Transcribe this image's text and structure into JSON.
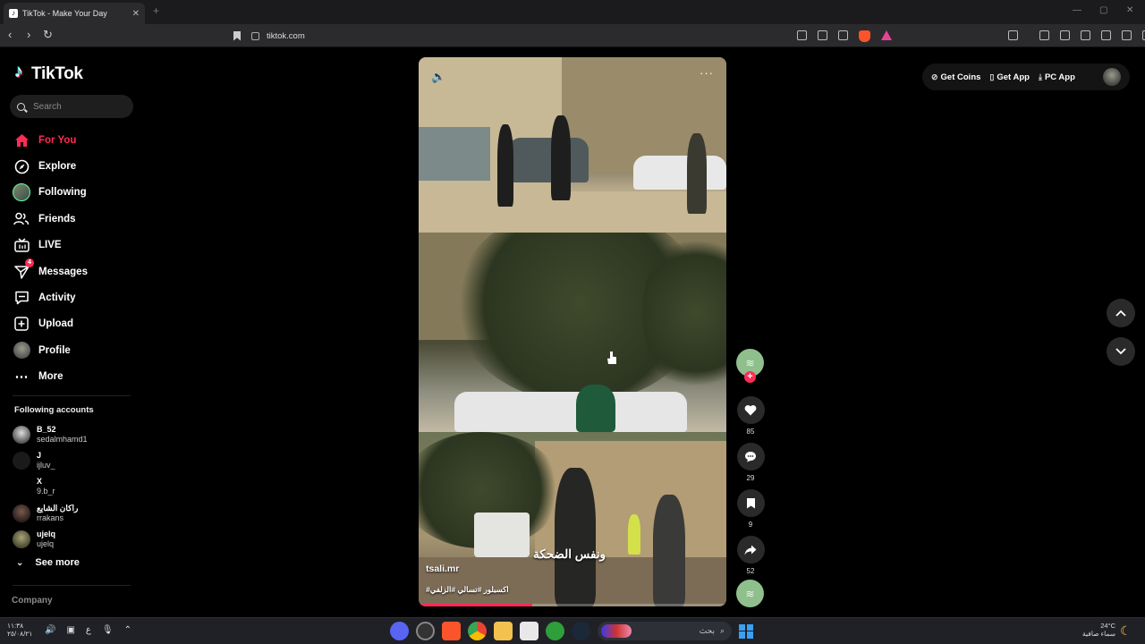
{
  "browser": {
    "tab_title": "TikTok - Make Your Day",
    "tab_close": "✕",
    "new_tab": "+",
    "url": "tiktok.com",
    "window_controls": [
      "—",
      "▢",
      "✕"
    ]
  },
  "sidebar": {
    "logo": "TikTok",
    "search_placeholder": "Search",
    "nav": [
      {
        "label": "For You",
        "icon": "home-icon"
      },
      {
        "label": "Explore",
        "icon": "compass-icon"
      },
      {
        "label": "Following",
        "icon": "following-avatar-icon"
      },
      {
        "label": "Friends",
        "icon": "friends-icon"
      },
      {
        "label": "LIVE",
        "icon": "live-icon"
      },
      {
        "label": "Messages",
        "icon": "messages-icon",
        "badge": "4"
      },
      {
        "label": "Activity",
        "icon": "activity-icon"
      },
      {
        "label": "Upload",
        "icon": "upload-icon"
      },
      {
        "label": "Profile",
        "icon": "profile-avatar-icon"
      },
      {
        "label": "More",
        "icon": "more-icon"
      }
    ],
    "following_title": "Following accounts",
    "following": [
      {
        "name": "B_52",
        "handle": "sedalmhamd1"
      },
      {
        "name": "J",
        "handle": "ijluv_"
      },
      {
        "name": "X",
        "handle": "9.b_r"
      },
      {
        "name": "راكان الشايع",
        "handle": "rrakans"
      },
      {
        "name": "ujelq",
        "handle": "ujelq"
      }
    ],
    "see_more": "See more",
    "company": "Company"
  },
  "video": {
    "caption": "ونفس الضحكة",
    "author": "tsali.mr",
    "hashtags": "#اكسبلور #تسالي #الزلفي",
    "progress": 0.37
  },
  "actions": {
    "likes": "85",
    "comments": "29",
    "saves": "9",
    "shares": "52"
  },
  "topbar": {
    "get_coins": "Get Coins",
    "get_app": "Get App",
    "pc_app": "PC App"
  },
  "taskbar": {
    "time": "١١:٣٨",
    "date": "٢٥/٠٨/٢١",
    "lang": "ع",
    "search_text": "بحث",
    "temperature": "24°C",
    "weather": "سماء صافية"
  },
  "colors": {
    "accent": "#fe2c55",
    "background": "#000000",
    "sidebar_search_bg": "#1e1e1e",
    "action_bg": "#2a2a2a"
  }
}
